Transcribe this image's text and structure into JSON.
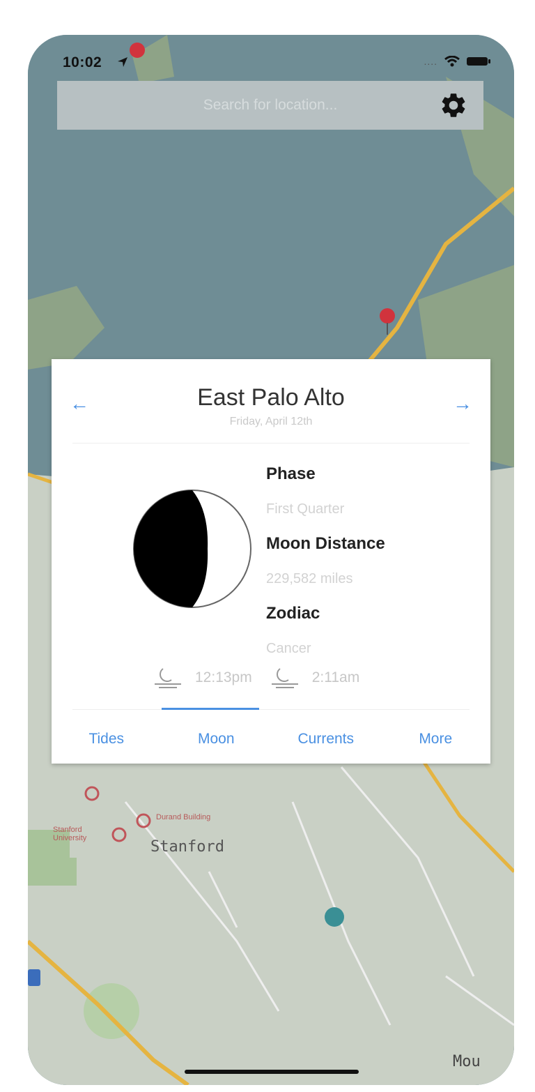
{
  "status_bar": {
    "time": "10:02",
    "signal": "....",
    "icons": [
      "location-arrow-icon",
      "wifi-icon",
      "battery-icon"
    ]
  },
  "search": {
    "placeholder": "Search for location..."
  },
  "settings": {
    "icon": "gear-icon"
  },
  "map": {
    "labels": {
      "stanford": "Stanford",
      "stanford_university": "Stanford University",
      "building": "Durand Building",
      "mountain": "Mou"
    },
    "colors": {
      "water": "#6f8d95",
      "land": "#c7cfc2",
      "park": "#a8c39a",
      "road": "#e5b441"
    }
  },
  "card": {
    "title": "East Palo Alto",
    "subtitle": "Friday, April 12th",
    "prev_arrow": "←",
    "next_arrow": "→",
    "phase_label": "Phase",
    "phase_value": "First Quarter",
    "distance_label": "Moon Distance",
    "distance_value": "229,582 miles",
    "zodiac_label": "Zodiac",
    "zodiac_value": "Cancer",
    "moonrise_time": "12:13pm",
    "moonset_time": "2:11am",
    "tabs": [
      "Tides",
      "Moon",
      "Currents",
      "More"
    ],
    "active_tab": "Moon",
    "accent_color": "#4a90e2"
  }
}
